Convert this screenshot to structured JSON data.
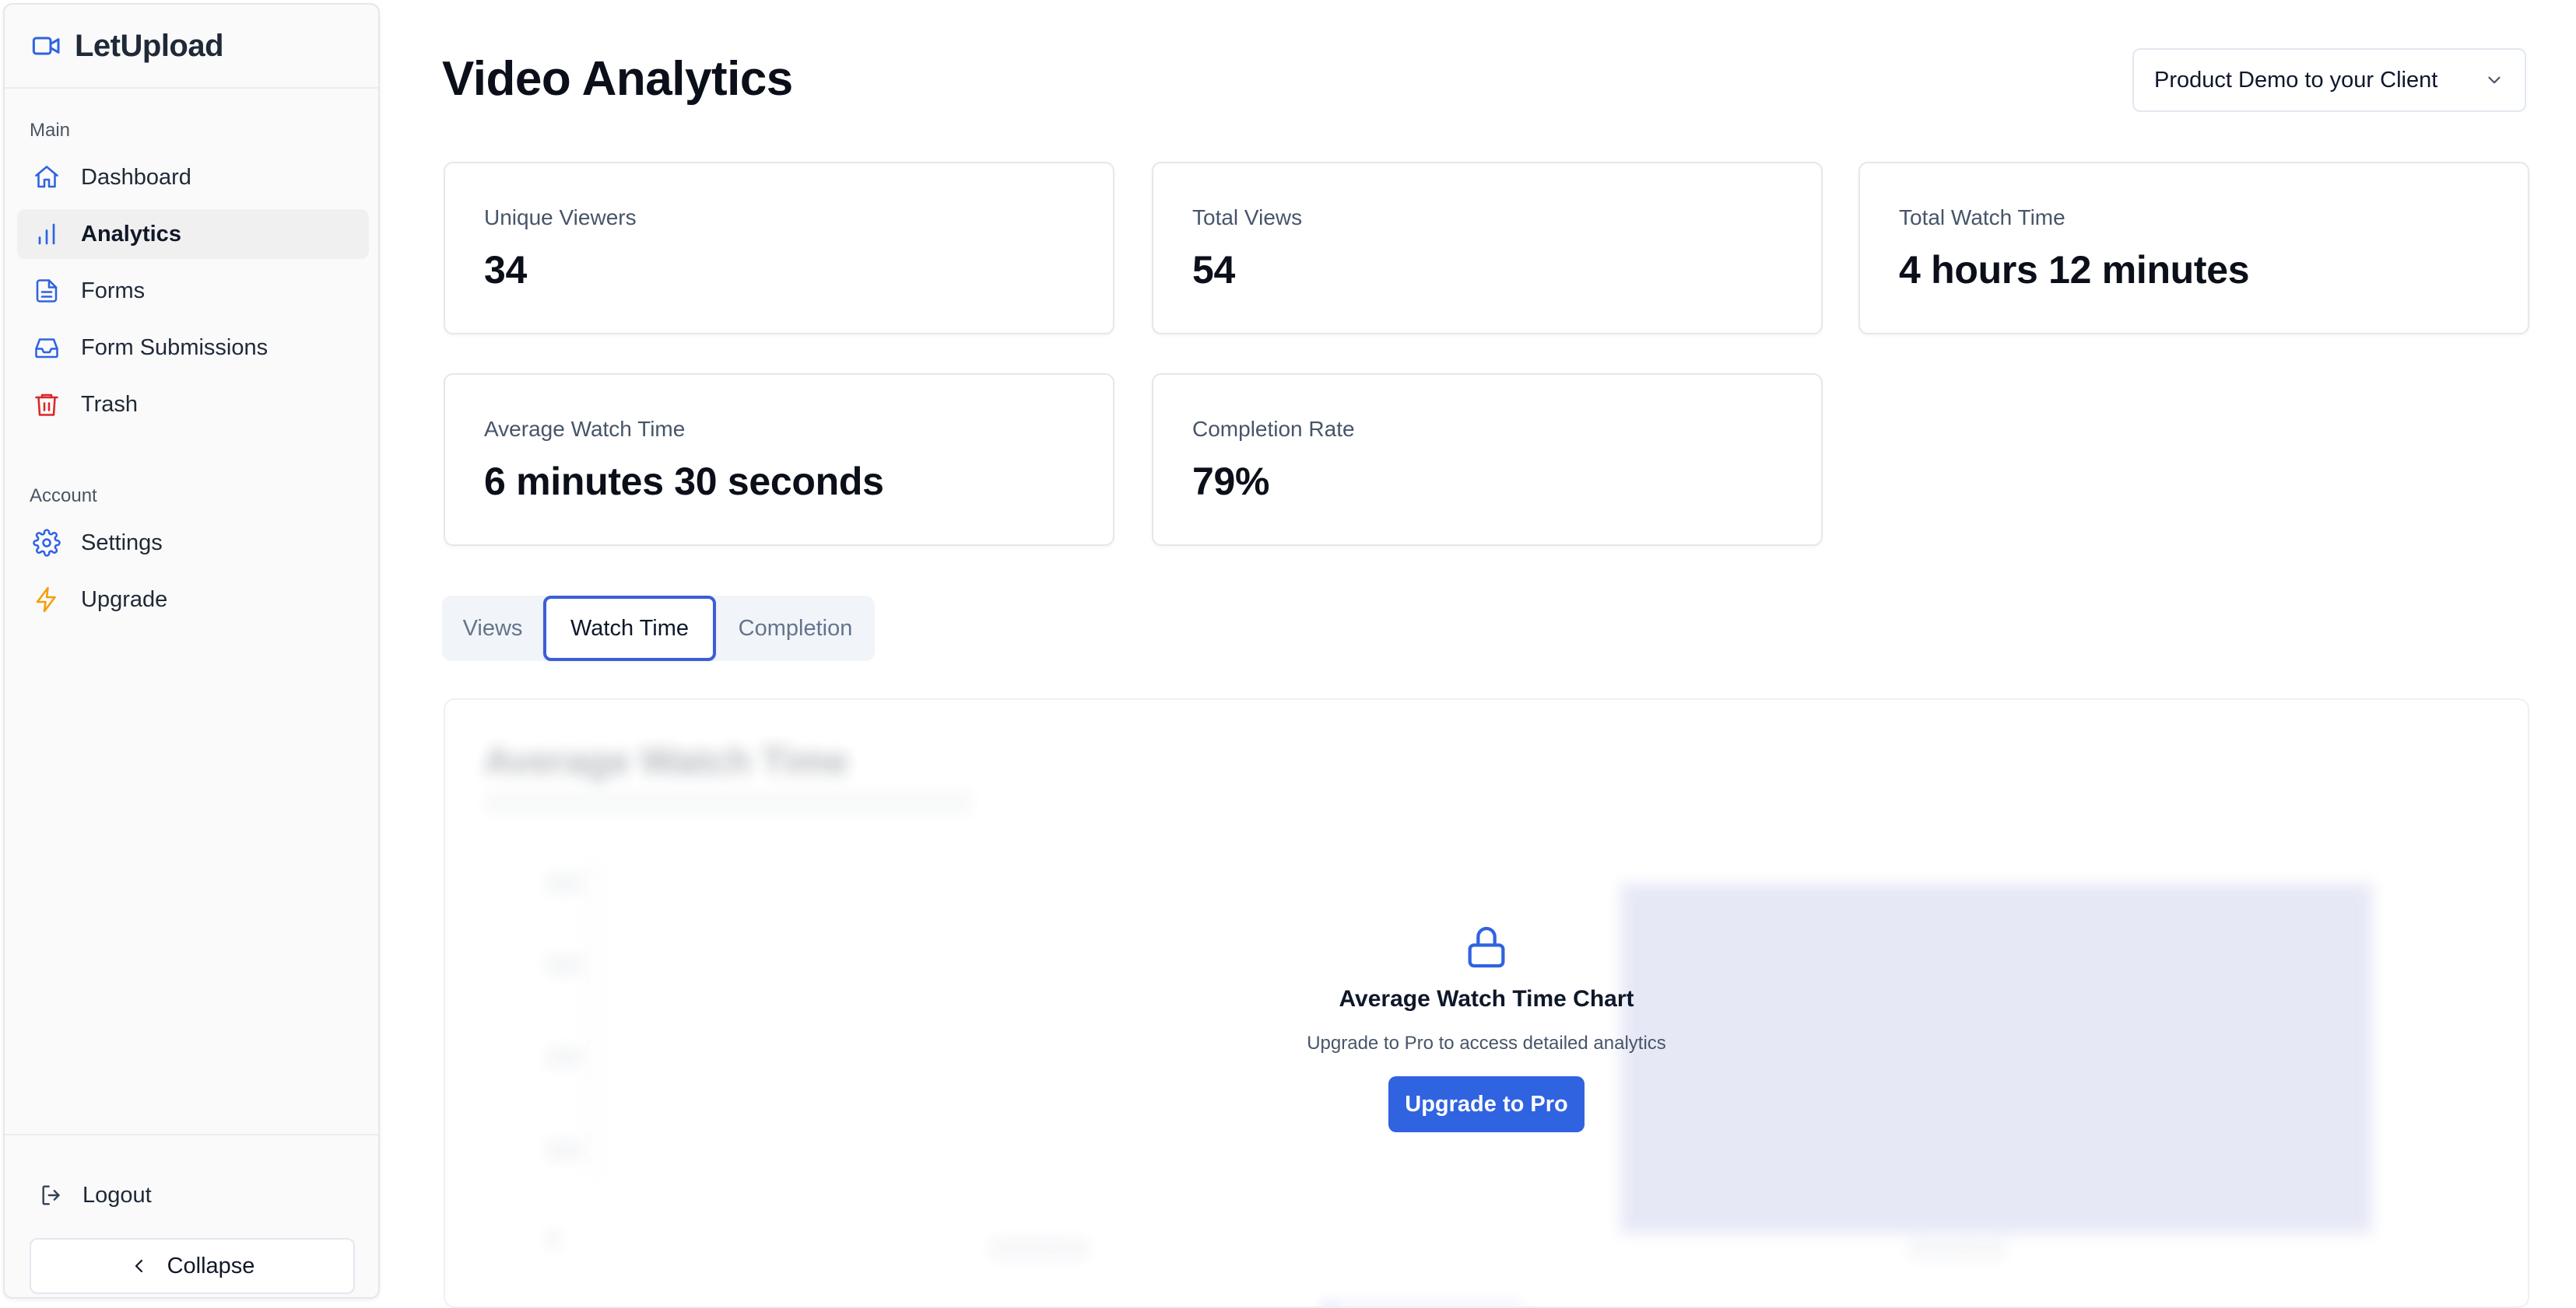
{
  "app": {
    "brand_name": "LetUpload",
    "brand_icon": "video-camera-icon"
  },
  "sidebar": {
    "main_section_label": "Main",
    "main_items": [
      {
        "label": "Dashboard",
        "icon": "home-icon",
        "active": false
      },
      {
        "label": "Analytics",
        "icon": "bar-chart-icon",
        "active": true
      },
      {
        "label": "Forms",
        "icon": "document-icon",
        "active": false
      },
      {
        "label": "Form Submissions",
        "icon": "inbox-icon",
        "active": false
      },
      {
        "label": "Trash",
        "icon": "trash-icon",
        "active": false,
        "color": "#dc2626"
      }
    ],
    "account_section_label": "Account",
    "account_items": [
      {
        "label": "Settings",
        "icon": "gear-icon"
      },
      {
        "label": "Upgrade",
        "icon": "lightning-icon",
        "color": "#f59e0b"
      }
    ],
    "logout_label": "Logout",
    "collapse_label": "Collapse"
  },
  "header": {
    "title": "Video Analytics",
    "video_select_value": "Product Demo to your Client"
  },
  "stats": [
    {
      "label": "Unique Viewers",
      "value": "34"
    },
    {
      "label": "Total Views",
      "value": "54"
    },
    {
      "label": "Total Watch Time",
      "value": "4 hours 12 minutes"
    },
    {
      "label": "Average Watch Time",
      "value": "6 minutes 30 seconds"
    },
    {
      "label": "Completion Rate",
      "value": "79%"
    }
  ],
  "tabs": [
    {
      "label": "Views",
      "active": false
    },
    {
      "label": "Watch Time",
      "active": true
    },
    {
      "label": "Completion",
      "active": false
    }
  ],
  "locked_chart": {
    "blurred_title": "Average Watch Time",
    "overlay_title": "Average Watch Time Chart",
    "overlay_description": "Upgrade to Pro to access detailed analytics",
    "upgrade_button_label": "Upgrade to Pro"
  },
  "colors": {
    "accent": "#2f63e0",
    "active_tab_border": "#3b5ed6",
    "trash": "#dc2626",
    "upgrade": "#f59e0b"
  }
}
